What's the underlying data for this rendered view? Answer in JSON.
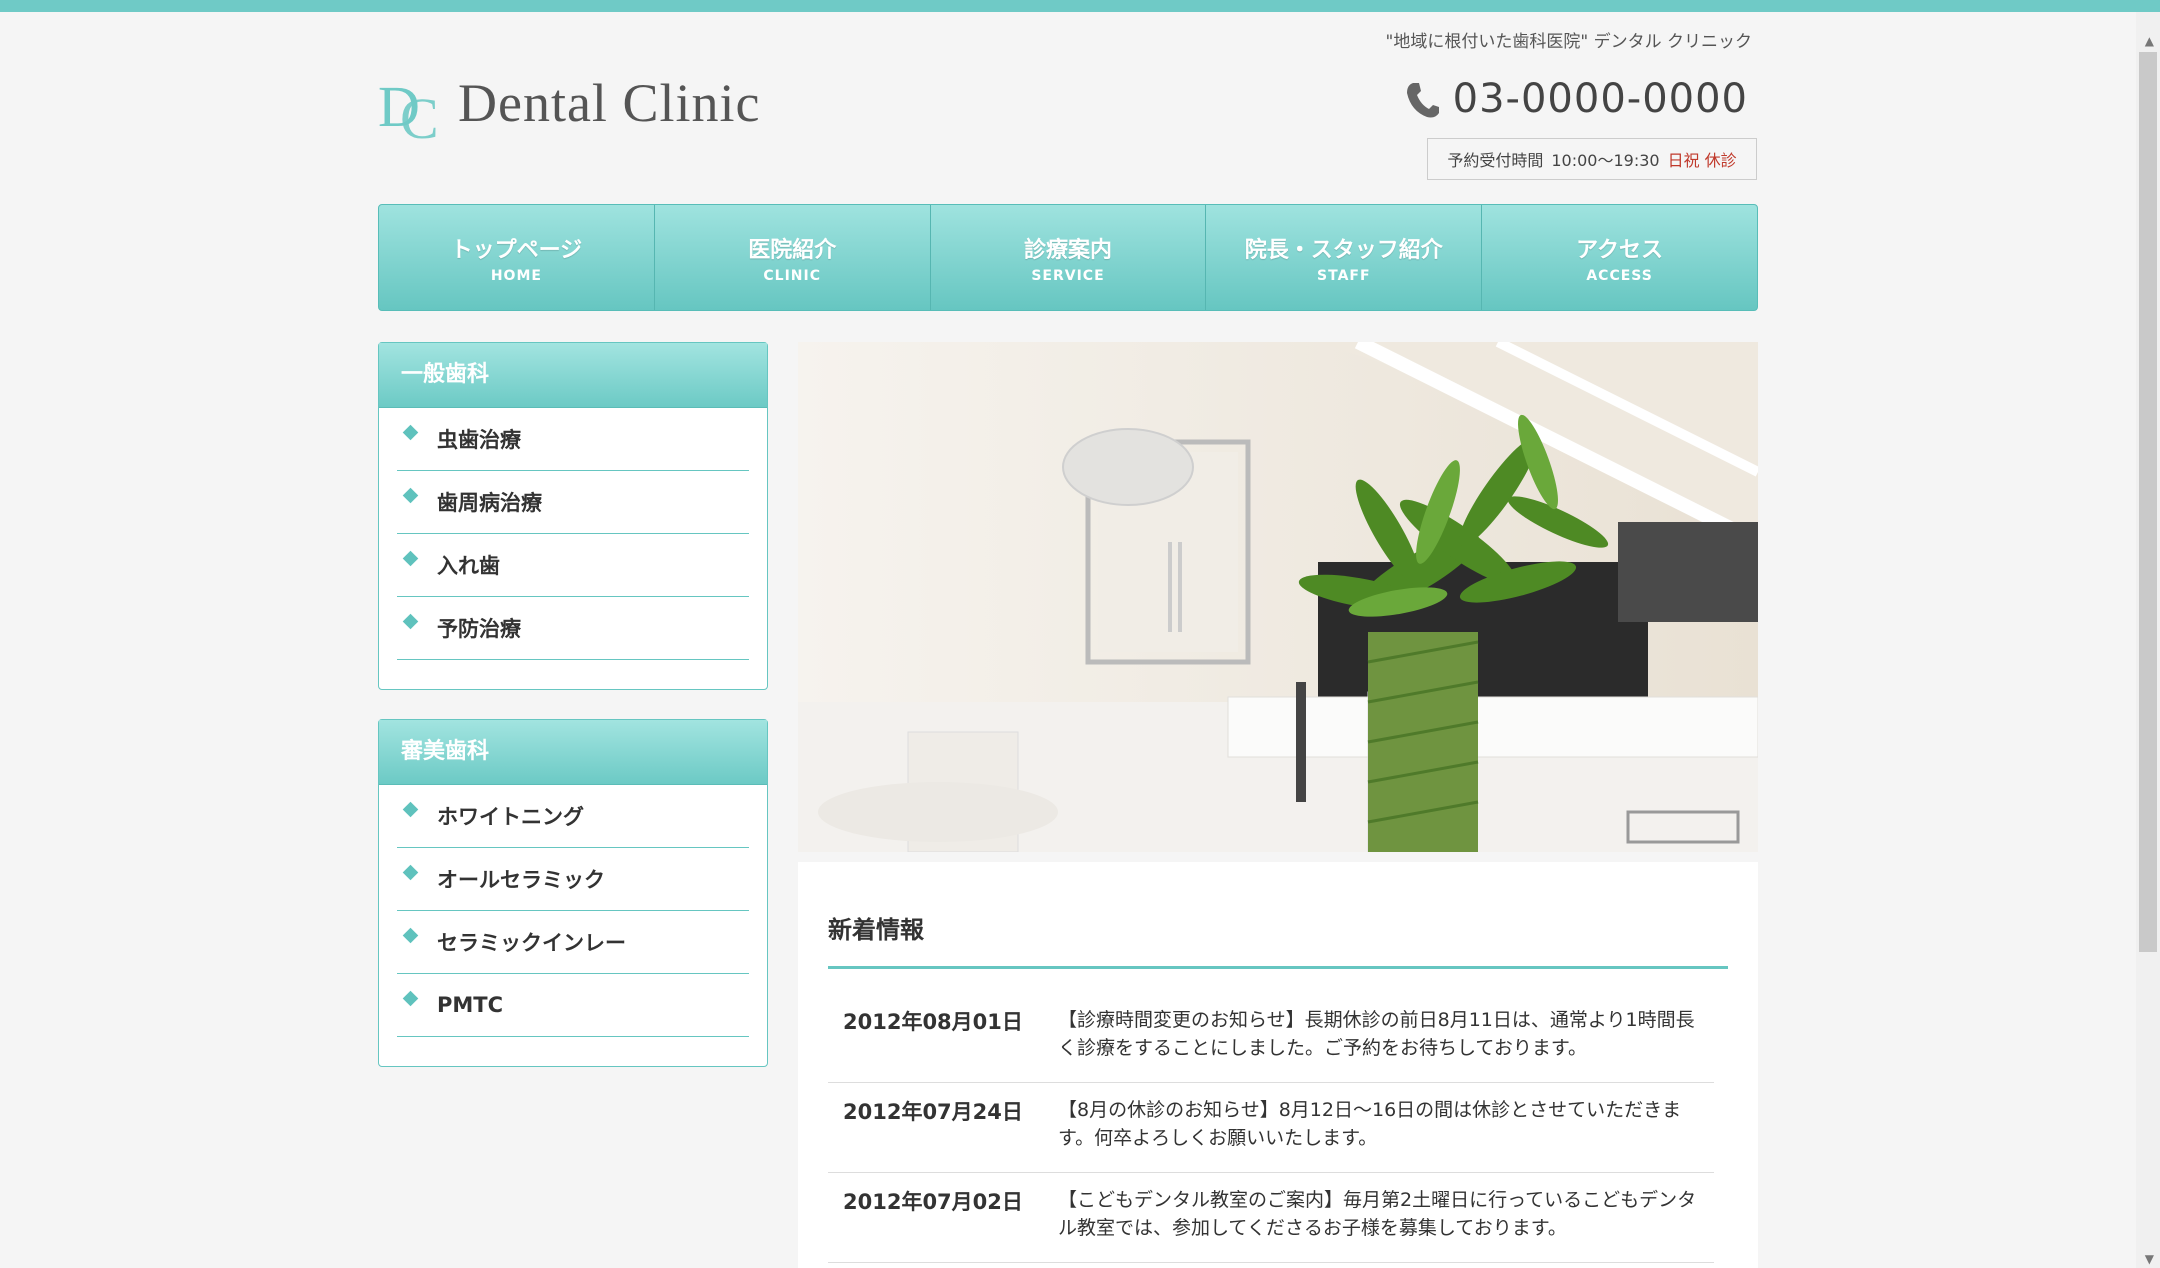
{
  "header": {
    "tagline": "\"地域に根付いた歯科医院\" デンタル クリニック",
    "logo_text": "Dental Clinic",
    "phone": "03-0000-0000",
    "hours_label": "予約受付時間",
    "hours_time": "10:00～19:30",
    "hours_closed": "日祝 休診"
  },
  "nav": [
    {
      "jp": "トップページ",
      "en": "HOME"
    },
    {
      "jp": "医院紹介",
      "en": "CLINIC"
    },
    {
      "jp": "診療案内",
      "en": "SERVICE"
    },
    {
      "jp": "院長・スタッフ紹介",
      "en": "STAFF"
    },
    {
      "jp": "アクセス",
      "en": "ACCESS"
    }
  ],
  "sidebar": {
    "general": {
      "title": "一般歯科",
      "items": [
        "虫歯治療",
        "歯周病治療",
        "入れ歯",
        "予防治療"
      ]
    },
    "cosmetic": {
      "title": "審美歯科",
      "items": [
        "ホワイトニング",
        "オールセラミック",
        "セラミックインレー",
        "PMTC"
      ]
    }
  },
  "news": {
    "title": "新着情報",
    "items": [
      {
        "date": "2012年08月01日",
        "text": "【診療時間変更のお知らせ】長期休診の前日8月11日は、通常より1時間長く診療をすることにしました。ご予約をお待ちしております。"
      },
      {
        "date": "2012年07月24日",
        "text": "【8月の休診のお知らせ】8月12日～16日の間は休診とさせていただきます。何卒よろしくお願いいたします。"
      },
      {
        "date": "2012年07月02日",
        "text": "【こどもデンタル教室のご案内】毎月第2土曜日に行っているこどもデンタル教室では、参加してくださるお子様を募集しております。"
      }
    ]
  },
  "colors": {
    "accent": "#6fcac6",
    "closed": "#c0392b"
  }
}
